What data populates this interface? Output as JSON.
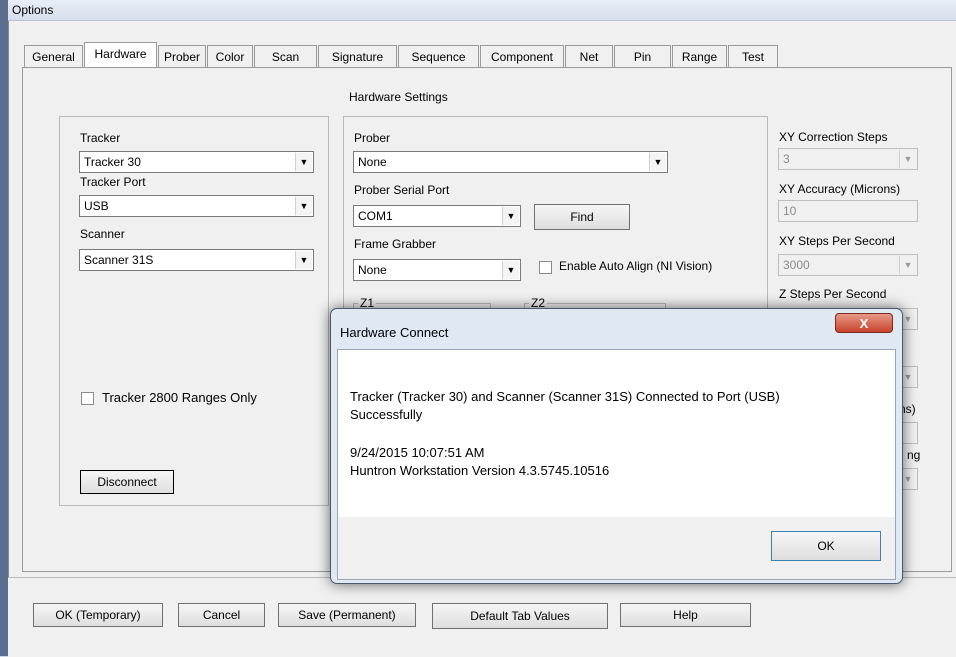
{
  "window": {
    "title": "Options"
  },
  "tabs": [
    "General",
    "Hardware",
    "Prober",
    "Color",
    "Scan",
    "Signature",
    "Sequence",
    "Component",
    "Net",
    "Pin",
    "Range",
    "Test"
  ],
  "panel": {
    "heading": "Hardware Settings"
  },
  "left_group": {
    "tracker_label": "Tracker",
    "tracker_value": "Tracker 30",
    "tracker_port_label": "Tracker Port",
    "tracker_port_value": "USB",
    "scanner_label": "Scanner",
    "scanner_value": "Scanner 31S",
    "ranges_checkbox_label": "Tracker 2800 Ranges Only",
    "disconnect_label": "Disconnect"
  },
  "right_group": {
    "prober_label": "Prober",
    "prober_value": "None",
    "prober_port_label": "Prober Serial Port",
    "prober_port_value": "COM1",
    "find_label": "Find",
    "frame_grabber_label": "Frame Grabber",
    "frame_grabber_value": "None",
    "auto_align_label": "Enable Auto Align (NI Vision)",
    "z1_label": "Z1",
    "z2_label": "Z2",
    "xy_correction_label": "XY Correction Steps",
    "xy_correction_value": "3",
    "xy_accuracy_label": "XY Accuracy (Microns)",
    "xy_accuracy_value": "10",
    "xy_steps_label": "XY Steps Per Second",
    "xy_steps_value": "3000",
    "z_steps_label": "Z Steps Per Second",
    "partial_ns": "ns)",
    "partial_ng": "ng"
  },
  "dialog": {
    "title": "Hardware Connect",
    "close_glyph": "X",
    "message_line1": "Tracker (Tracker 30) and Scanner (Scanner 31S) Connected to Port (USB)",
    "message_line2": "Successfully",
    "timestamp": "9/24/2015 10:07:51 AM",
    "version": "Huntron Workstation Version 4.3.5745.10516",
    "ok_label": "OK"
  },
  "footer": {
    "ok_temp": "OK (Temporary)",
    "cancel": "Cancel",
    "save_perm": "Save (Permanent)",
    "default_tab": "Default Tab Values",
    "help": "Help"
  }
}
